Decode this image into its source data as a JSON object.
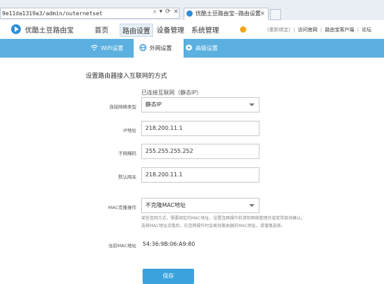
{
  "browser": {
    "address": "9e11da1319a3/admin/outernetset",
    "search_icon": "search-icon",
    "refresh_icon": "refresh-icon",
    "tab_title": "优酷土豆路由宝--路由设置",
    "tab_close": "×"
  },
  "header": {
    "app_name": "优酷土豆路由宝",
    "nav": [
      "首页",
      "路由设置",
      "设备管理",
      "系统管理"
    ],
    "active_nav": "路由设置",
    "links": {
      "rebind": "(重新绑定)",
      "sep1": "|",
      "official": "访问官网",
      "sep2": "|",
      "client": "路由宝客户端",
      "sep3": "|",
      "forum": "论坛"
    }
  },
  "subtabs": [
    {
      "label": "WiFi设置",
      "icon": "wifi-icon"
    },
    {
      "label": "外网设置",
      "icon": "globe-icon"
    },
    {
      "label": "高级设置",
      "icon": "gear-icon"
    }
  ],
  "active_subtab": "外网设置",
  "form": {
    "heading": "设置路由器接入互联网的方式",
    "status": "已连接互联网（静态IP）",
    "conn_type_label": "连接网络类型",
    "conn_type_value": "静态IP",
    "ip_label": "IP地址",
    "ip_value": "218.200.11.1",
    "mask_label": "子网掩码",
    "mask_value": "255.255.255.252",
    "gateway_label": "默认网关",
    "gateway_value": "218.200.11.1",
    "mac_op_label": "MAC克隆操作",
    "mac_op_value": "不克隆MAC地址",
    "mac_note_1": "某些连网方式，需要绑定的MAC地址，设置连网操作前请和网络管理员或宽带商询确认。",
    "mac_note_2": "选择MAC地址克隆后，在连网操作时会更改路由器的MAC地址，请谨慎选择。",
    "current_mac_label": "当前MAC地址",
    "current_mac_value": "54:36:9B:06:A9:80",
    "save_label": "保存"
  },
  "colors": {
    "accent": "#5bb0e0",
    "button": "#3aa3de",
    "coin": "#f2a71b"
  }
}
